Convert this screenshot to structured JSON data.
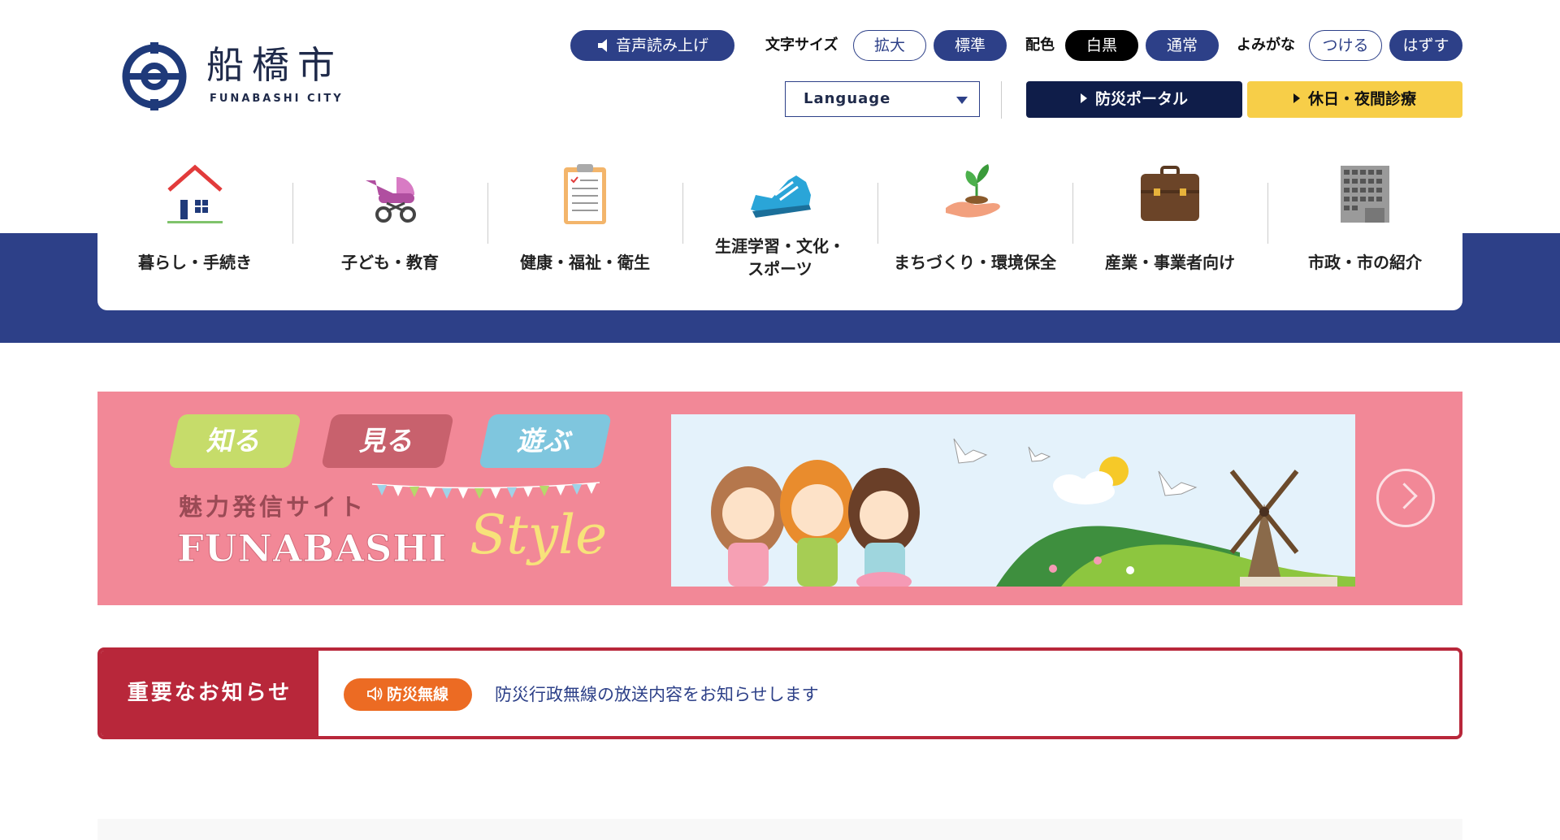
{
  "header": {
    "logo": {
      "name_ja": "船橋市",
      "name_en": "FUNABASHI CITY"
    },
    "read_aloud": "音声読み上げ",
    "font_size": {
      "label": "文字サイズ",
      "enlarge": "拡大",
      "standard": "標準"
    },
    "color_scheme": {
      "label": "配色",
      "monochrome": "白黒",
      "normal": "通常"
    },
    "furigana": {
      "label": "よみがな",
      "on": "つける",
      "off": "はずす"
    },
    "language": {
      "selected": "Language"
    },
    "disaster_portal": "防災ポータル",
    "holiday_clinic": "休日・夜間診療"
  },
  "nav": {
    "items": [
      {
        "label": "暮らし・手続き",
        "icon": "house-icon"
      },
      {
        "label": "子ども・教育",
        "icon": "stroller-icon"
      },
      {
        "label": "健康・福祉・衛生",
        "icon": "clipboard-icon"
      },
      {
        "label_line1": "生涯学習・文化・",
        "label_line2": "スポーツ",
        "icon": "sneaker-icon"
      },
      {
        "label": "まちづくり・環境保全",
        "icon": "sprout-hand-icon"
      },
      {
        "label": "産業・事業者向け",
        "icon": "briefcase-icon"
      },
      {
        "label": "市政・市の紹介",
        "icon": "building-icon"
      }
    ]
  },
  "banner": {
    "tags": [
      "知る",
      "見る",
      "遊ぶ"
    ],
    "subtitle": "魅力発信サイト",
    "title": "FUNABASHI",
    "title_script": "Style"
  },
  "notice": {
    "heading": "重要なお知らせ",
    "badge": "防災無線",
    "text": "防災行政無線の放送内容をお知らせします"
  },
  "colors": {
    "navy": "#2d4088",
    "dark_navy": "#0f1d49",
    "yellow": "#f7ce48",
    "banner_pink": "#f28897",
    "notice_red": "#b8273a",
    "badge_orange": "#ec6b23"
  }
}
